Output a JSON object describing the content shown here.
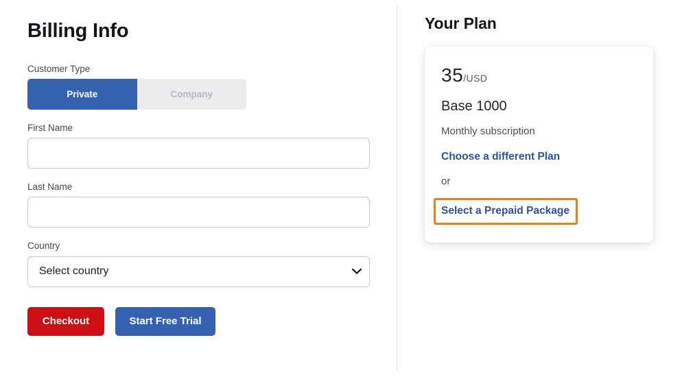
{
  "billing": {
    "title": "Billing Info",
    "customer_type": {
      "label": "Customer Type",
      "options": [
        {
          "label": "Private",
          "selected": true
        },
        {
          "label": "Company",
          "selected": false
        }
      ]
    },
    "first_name": {
      "label": "First Name",
      "value": "",
      "placeholder": ""
    },
    "last_name": {
      "label": "Last Name",
      "value": "",
      "placeholder": ""
    },
    "country": {
      "label": "Country",
      "selected": "Select country",
      "chevron_icon": "chevron-down-icon"
    },
    "actions": {
      "checkout_label": "Checkout",
      "trial_label": "Start Free Trial",
      "checkout_color": "#cc1016",
      "trial_color": "#3461b0"
    }
  },
  "plan": {
    "title": "Your Plan",
    "price_amount": "35",
    "price_currency": "/USD",
    "name": "Base 1000",
    "period": "Monthly subscription",
    "change_plan_link": "Choose a different Plan",
    "or_text": "or",
    "prepaid_link": "Select a Prepaid Package",
    "link_color": "#2a52a0",
    "highlight_color": "#f07c13"
  }
}
